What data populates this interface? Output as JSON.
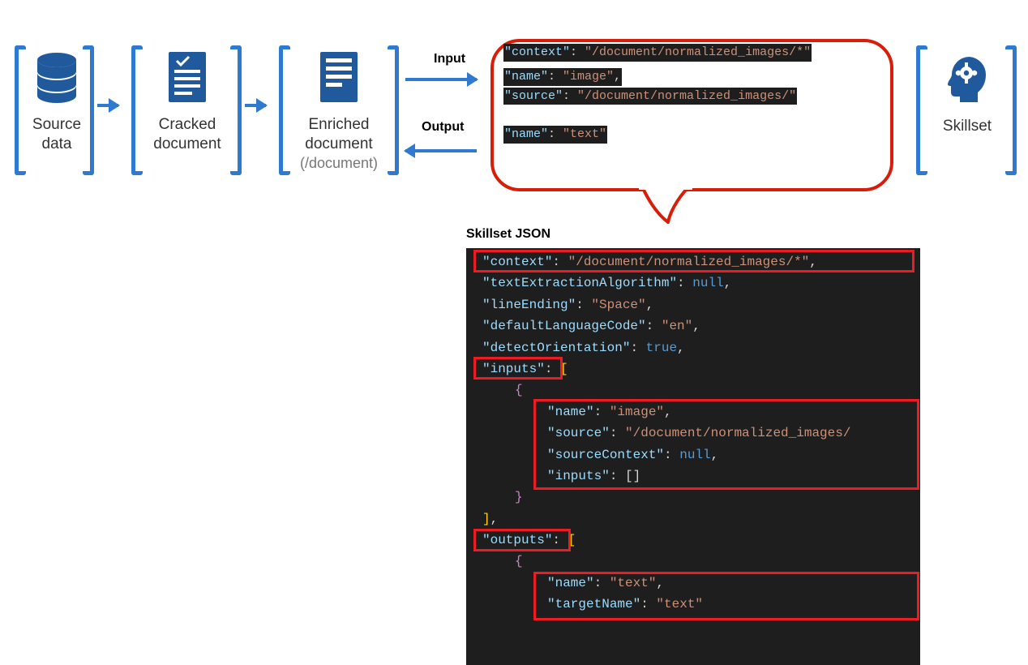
{
  "stages": {
    "source": {
      "line1": "Source",
      "line2": "data"
    },
    "cracked": {
      "line1": "Cracked",
      "line2": "document"
    },
    "enriched": {
      "line1": "Enriched",
      "line2": "document",
      "sub": "(/document)"
    },
    "skillset": {
      "label": "Skillset"
    }
  },
  "io": {
    "input": "Input",
    "output": "Output"
  },
  "bubble": {
    "context": {
      "key": "\"context\"",
      "val": "\"/document/normalized_images/*\""
    },
    "name_img": {
      "key": "\"name\"",
      "val": "\"image\""
    },
    "source": {
      "key": "\"source\"",
      "val": "\"/document/normalized_images/\""
    },
    "name_txt": {
      "key": "\"name\"",
      "val": "\"text\""
    }
  },
  "json": {
    "title": "Skillset JSON",
    "lines": {
      "context": {
        "key": "\"context\"",
        "val": "\"/document/normalized_images/*\""
      },
      "textExtraction": {
        "key": "\"textExtractionAlgorithm\"",
        "val": "null"
      },
      "lineEnding": {
        "key": "\"lineEnding\"",
        "val": "\"Space\""
      },
      "defaultLang": {
        "key": "\"defaultLanguageCode\"",
        "val": "\"en\""
      },
      "detectOrient": {
        "key": "\"detectOrientation\"",
        "val": "true"
      },
      "inputs": {
        "key": "\"inputs\""
      },
      "inp_name": {
        "key": "\"name\"",
        "val": "\"image\""
      },
      "inp_source": {
        "key": "\"source\"",
        "val": "\"/document/normalized_images/"
      },
      "inp_srcCtx": {
        "key": "\"sourceContext\"",
        "val": "null"
      },
      "inp_inputs": {
        "key": "\"inputs\""
      },
      "outputs": {
        "key": "\"outputs\""
      },
      "out_name": {
        "key": "\"name\"",
        "val": "\"text\""
      },
      "out_target": {
        "key": "\"targetName\"",
        "val": "\"text\""
      }
    }
  }
}
